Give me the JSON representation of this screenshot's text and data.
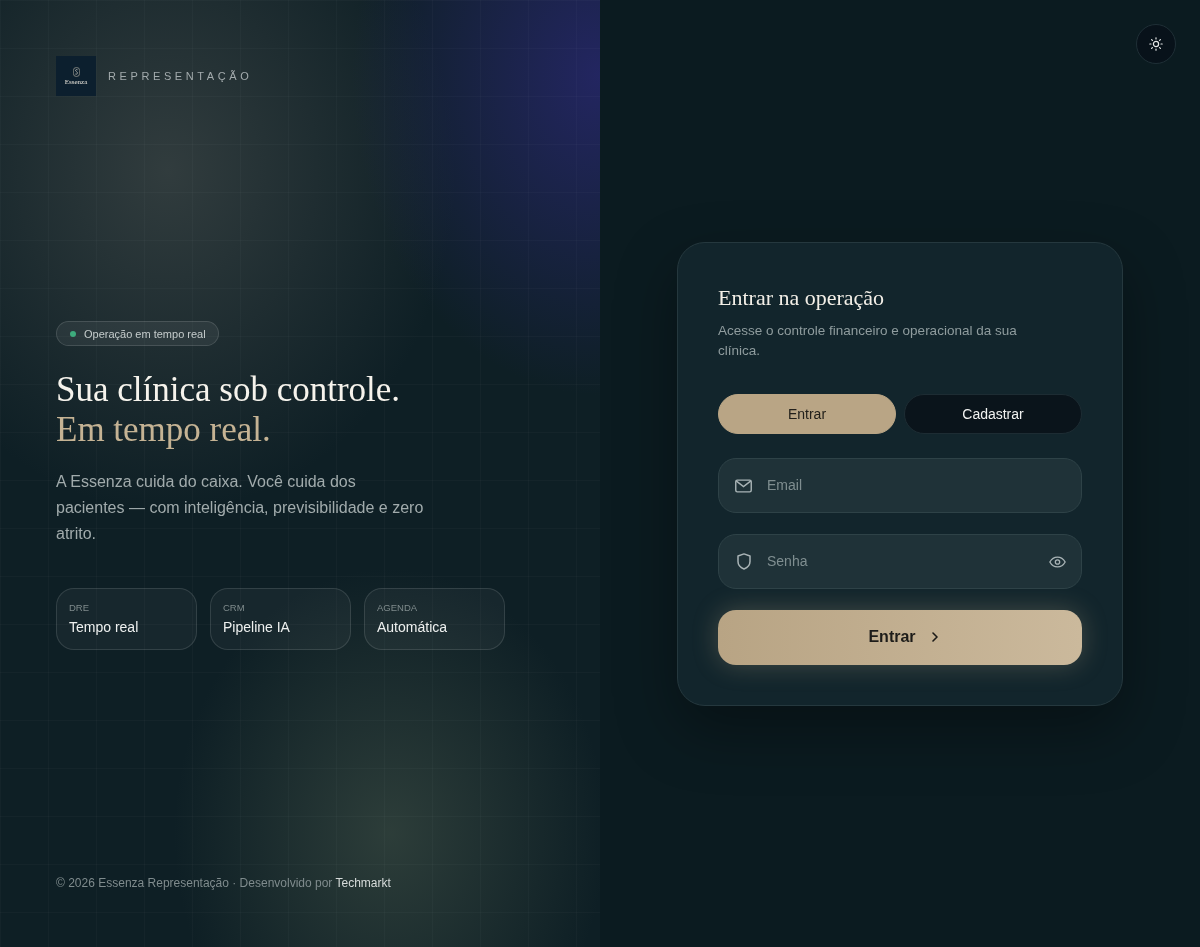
{
  "brand": {
    "logo_text": "Essenza",
    "name": "REPRESENTAÇÃO"
  },
  "status_badge": {
    "label": "Operação em tempo real"
  },
  "hero": {
    "title": "Sua clínica sob controle.",
    "highlight": "Em tempo real.",
    "description": "A Essenza cuida do caixa. Você cuida dos pacientes — com inteligência, previsibilidade e zero atrito."
  },
  "features": [
    {
      "label": "DRE",
      "value": "Tempo real"
    },
    {
      "label": "CRM",
      "value": "Pipeline IA"
    },
    {
      "label": "AGENDA",
      "value": "Automática"
    }
  ],
  "footer": {
    "text": "© 2026 Essenza Representação · Desenvolvido por",
    "link": "Techmarkt"
  },
  "login": {
    "title": "Entrar na operação",
    "subtitle": "Acesse o controle financeiro e operacional da sua clínica.",
    "tabs": [
      {
        "label": "Entrar",
        "selected": true
      },
      {
        "label": "Cadastrar",
        "selected": false
      }
    ],
    "fields": [
      {
        "kind": "email",
        "placeholder": "Email"
      },
      {
        "kind": "password",
        "placeholder": "Senha"
      }
    ],
    "submit": "Entrar"
  }
}
